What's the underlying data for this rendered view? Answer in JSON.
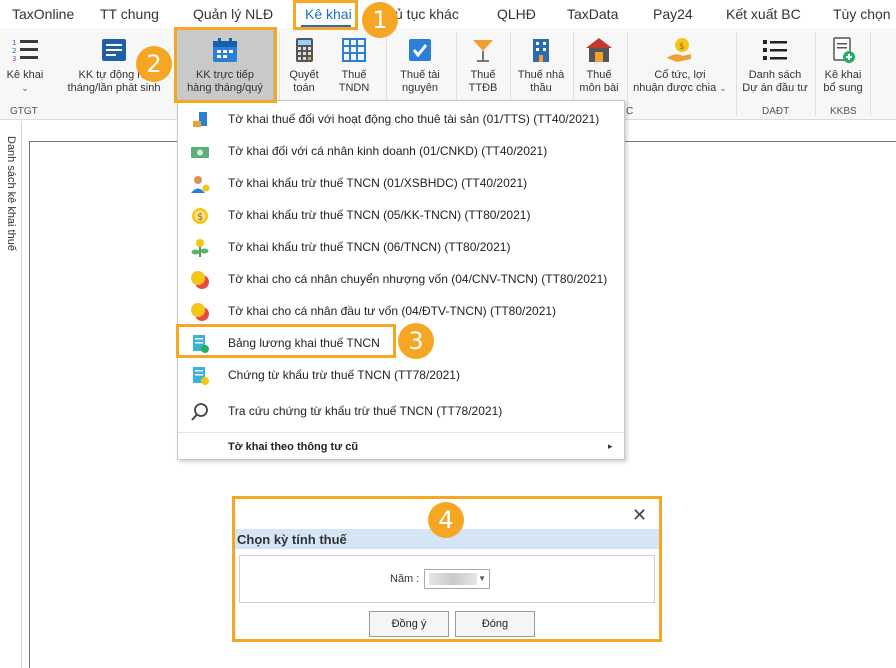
{
  "menubar": {
    "tabs": [
      {
        "label": "TaxOnline"
      },
      {
        "label": "TT chung"
      },
      {
        "label": "Quản lý NLĐ"
      },
      {
        "label": "Kê khai"
      },
      {
        "label": "ủ tục khác"
      },
      {
        "label": "QLHĐ"
      },
      {
        "label": "TaxData"
      },
      {
        "label": "Pay24"
      },
      {
        "label": "Kết xuất BC"
      },
      {
        "label": "Tùy chọn"
      }
    ],
    "active_tab": "Kê khai"
  },
  "ribbon": {
    "buttons": [
      {
        "line1": "Kê khai",
        "line2": "",
        "icon": "list-numbered-icon"
      },
      {
        "line1": "KK tự động hà",
        "line2": "tháng/lần phát sinh",
        "icon": "auto-declare-icon"
      },
      {
        "line1": "KK trực tiếp",
        "line2": "hàng tháng/quý",
        "icon": "calendar-icon"
      },
      {
        "line1": "Quyết",
        "line2": "toán",
        "icon": "calculator-icon"
      },
      {
        "line1": "Thuế",
        "line2": "TNDN",
        "icon": "grid-table-icon"
      },
      {
        "line1": "Thuế tài",
        "line2": "nguyên",
        "icon": "checkbox-icon"
      },
      {
        "line1": "Thuế",
        "line2": "TTĐB",
        "icon": "cocktail-icon"
      },
      {
        "line1": "Thuế nhà",
        "line2": "thầu",
        "icon": "building-icon"
      },
      {
        "line1": "Thuế",
        "line2": "môn bài",
        "icon": "shop-icon"
      },
      {
        "line1": "Cổ tức, lợi",
        "line2": "nhuận được chia",
        "icon": "coin-hand-icon"
      },
      {
        "line1": "Danh sách",
        "line2": "Dự án đầu tư",
        "icon": "bullet-list-icon"
      },
      {
        "line1": "Kê khai",
        "line2": "bổ sung",
        "icon": "add-document-icon"
      }
    ],
    "group_labels": {
      "gtgt": "GTGT",
      "dadt": "DAĐT",
      "kkbs": "KKBS",
      "partial": "C"
    }
  },
  "left_panel": {
    "label": "Danh sách kê khai thuế"
  },
  "dropdown": {
    "items": [
      {
        "label": "Tờ khai thuế đối với hoạt động cho thuê tài sản (01/TTS) (TT40/2021)",
        "icon": "property-rental-icon"
      },
      {
        "label": "Tờ khai đối với cá nhân kinh doanh (01/CNKD) (TT40/2021)",
        "icon": "money-bill-icon"
      },
      {
        "label": "Tờ khai khấu trừ thuế TNCN (01/XSBHDC) (TT40/2021)",
        "icon": "person-coin-icon"
      },
      {
        "label": "Tờ khai khấu trừ thuế TNCN (05/KK-TNCN) (TT80/2021)",
        "icon": "dollar-coin-icon"
      },
      {
        "label": "Tờ khai khấu trừ thuế TNCN (06/TNCN) (TT80/2021)",
        "icon": "money-plant-icon"
      },
      {
        "label": "Tờ khai cho cá nhân chuyển nhượng vốn (04/CNV-TNCN) (TT80/2021)",
        "icon": "coins-stack-icon"
      },
      {
        "label": "Tờ khai cho cá nhân đầu tư vốn (04/ĐTV-TNCN) (TT80/2021)",
        "icon": "coins-invest-icon"
      },
      {
        "label": "Bảng lương khai thuế TNCN",
        "icon": "payroll-sheet-icon"
      },
      {
        "label": "Chứng từ khấu trừ thuế TNCN (TT78/2021)",
        "icon": "certificate-doc-icon"
      },
      {
        "label": "Tra cứu chứng từ khấu trừ thuế TNCN (TT78/2021)",
        "icon": "magnifier-icon"
      }
    ],
    "footer": {
      "label": "Tờ khai theo thông tư cũ",
      "arrow": "▸"
    }
  },
  "steps": {
    "s1": "1",
    "s2": "2",
    "s3": "3",
    "s4": "4"
  },
  "dialog": {
    "close": "✕",
    "title": "Chọn kỳ tính thuế",
    "year_label": "Năm :",
    "ok_label": "Đồng ý",
    "close_label": "Đóng"
  },
  "colors": {
    "highlight": "#f5a623",
    "active_tab": "#1f6fbf",
    "dialog_title_bg": "#d4e6f5"
  }
}
